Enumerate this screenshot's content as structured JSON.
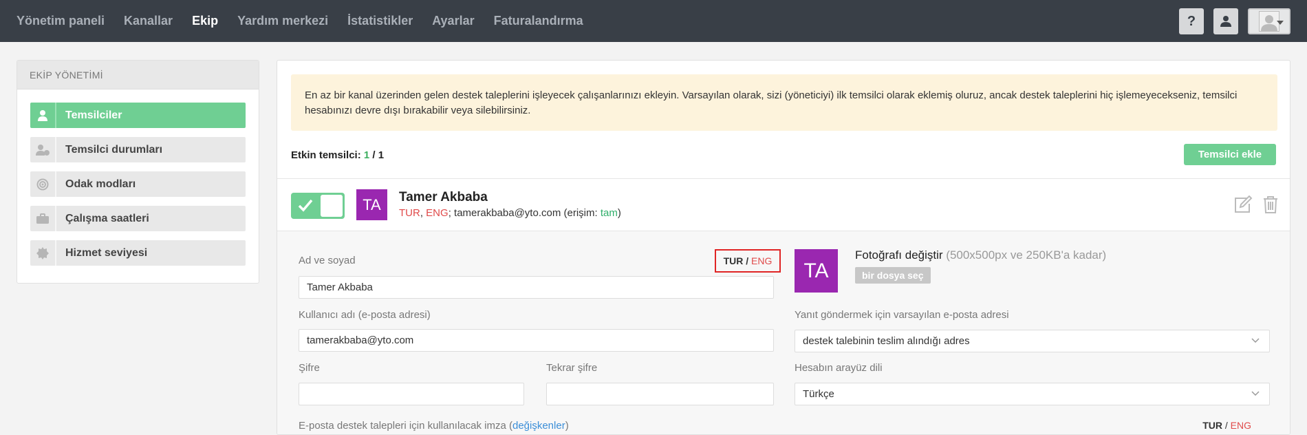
{
  "nav": {
    "items": [
      {
        "label": "Yönetim paneli"
      },
      {
        "label": "Kanallar"
      },
      {
        "label": "Ekip"
      },
      {
        "label": "Yardım merkezi"
      },
      {
        "label": "İstatistikler"
      },
      {
        "label": "Ayarlar"
      },
      {
        "label": "Faturalandırma"
      }
    ],
    "active": "Ekip",
    "help_label": "?"
  },
  "sidebar": {
    "title": "EKİP YÖNETİMİ",
    "items": [
      {
        "label": "Temsilciler",
        "icon": "user-icon",
        "active": true
      },
      {
        "label": "Temsilci durumları",
        "icon": "user-status-icon"
      },
      {
        "label": "Odak modları",
        "icon": "target-icon"
      },
      {
        "label": "Çalışma saatleri",
        "icon": "briefcase-icon"
      },
      {
        "label": "Hizmet seviyesi",
        "icon": "badge-icon"
      }
    ]
  },
  "main": {
    "notice": "En az bir kanal üzerinden gelen destek taleplerini işleyecek çalışanlarınızı ekleyin. Varsayılan olarak, sizi (yöneticiyi) ilk temsilci olarak eklemiş oluruz, ancak destek taleplerini hiç işlemeyecekseniz, temsilci hesabınızı devre dışı bırakabilir veya silebilirsiniz.",
    "active_label": "Etkin temsilci:",
    "active_count": "1",
    "active_sep": "/",
    "active_total": "1",
    "add_button": "Temsilci ekle"
  },
  "agent": {
    "initials": "TA",
    "name": "Tamer Akbaba",
    "lang_tur": "TUR",
    "lang_sep": ",",
    "lang_eng": "ENG",
    "email_part": "; tamerakbaba@yto.com (erişim: ",
    "access": "tam",
    "close_paren": ")"
  },
  "form": {
    "name_label": "Ad ve soyad",
    "name_value": "Tamer Akbaba",
    "lang_tur": "TUR",
    "lang_sep": " / ",
    "lang_eng": "ENG",
    "username_label": "Kullanıcı adı (e-posta adresi)",
    "username_value": "tamerakbaba@yto.com",
    "password_label": "Şifre",
    "password_repeat_label": "Tekrar şifre",
    "photo_title": "Fotoğrafı değiştir",
    "photo_hint": " (500x500px ve 250KB'a kadar)",
    "file_button": "bir dosya seç",
    "reply_email_label": "Yanıt göndermek için varsayılan e-posta adresi",
    "reply_email_value": "destek talebinin teslim alındığı adres",
    "ui_lang_label": "Hesabın arayüz dili",
    "ui_lang_value": "Türkçe",
    "signature_label": "E-posta destek talepleri için kullanılacak imza (",
    "signature_link": "değişkenler",
    "signature_close": ")"
  },
  "colors": {
    "topbar": "#393f47",
    "accent_green": "#6fcf93",
    "notice_bg": "#fdf3dc",
    "avatar_purple": "#9a27b0",
    "lang_red": "#e04a4a",
    "highlight_red": "#e02424"
  }
}
